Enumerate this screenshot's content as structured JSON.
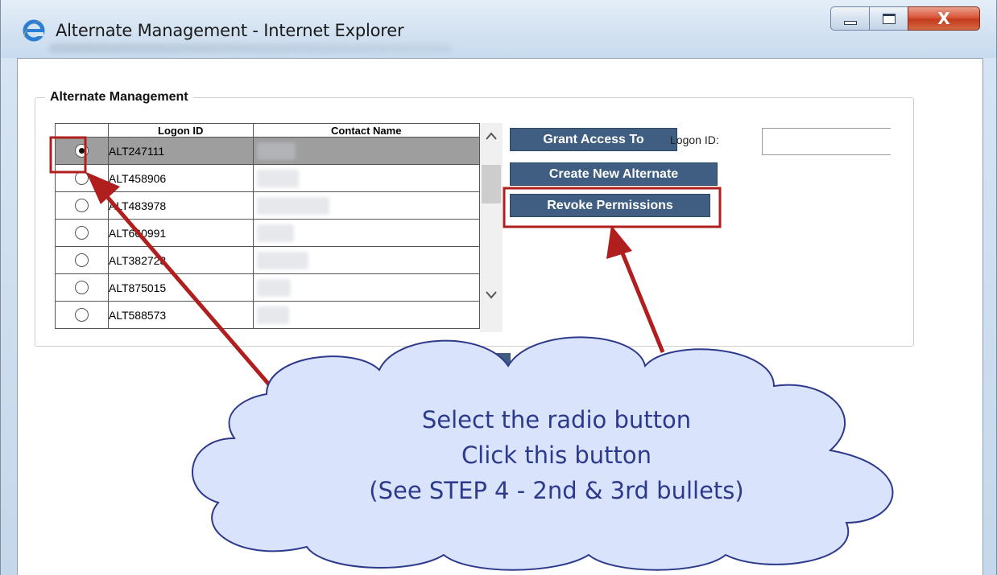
{
  "window": {
    "title": "Alternate Management - Internet Explorer",
    "close_glyph": "X"
  },
  "panel": {
    "legend": "Alternate Management"
  },
  "grid": {
    "columns": [
      "",
      "Logon ID",
      "Contact Name"
    ],
    "rows": [
      {
        "logon_id": "ALT247111",
        "selected": true
      },
      {
        "logon_id": "ALT458906",
        "selected": false
      },
      {
        "logon_id": "ALT483978",
        "selected": false
      },
      {
        "logon_id": "ALT660991",
        "selected": false
      },
      {
        "logon_id": "ALT382723",
        "selected": false
      },
      {
        "logon_id": "ALT875015",
        "selected": false
      },
      {
        "logon_id": "ALT588573",
        "selected": false
      }
    ]
  },
  "actions": {
    "grant_access": "Grant Access To",
    "logon_id_label": "Logon ID:",
    "logon_id_value": "",
    "create_alternate": "Create New Alternate",
    "revoke_permissions": "Revoke Permissions"
  },
  "callout": {
    "line1": "Select the radio button",
    "line2": "Click this button",
    "line3": "(See STEP 4 - 2nd & 3rd bullets)"
  },
  "colors": {
    "button_bg": "#3f5e82",
    "annotation_red": "#b01e1e",
    "callout_fill": "#d9e3fb",
    "callout_text": "#2d3a8c"
  },
  "icons": [
    "ie-logo-icon",
    "minimize-icon",
    "maximize-icon",
    "close-icon",
    "chevron-up-icon",
    "chevron-down-icon"
  ]
}
